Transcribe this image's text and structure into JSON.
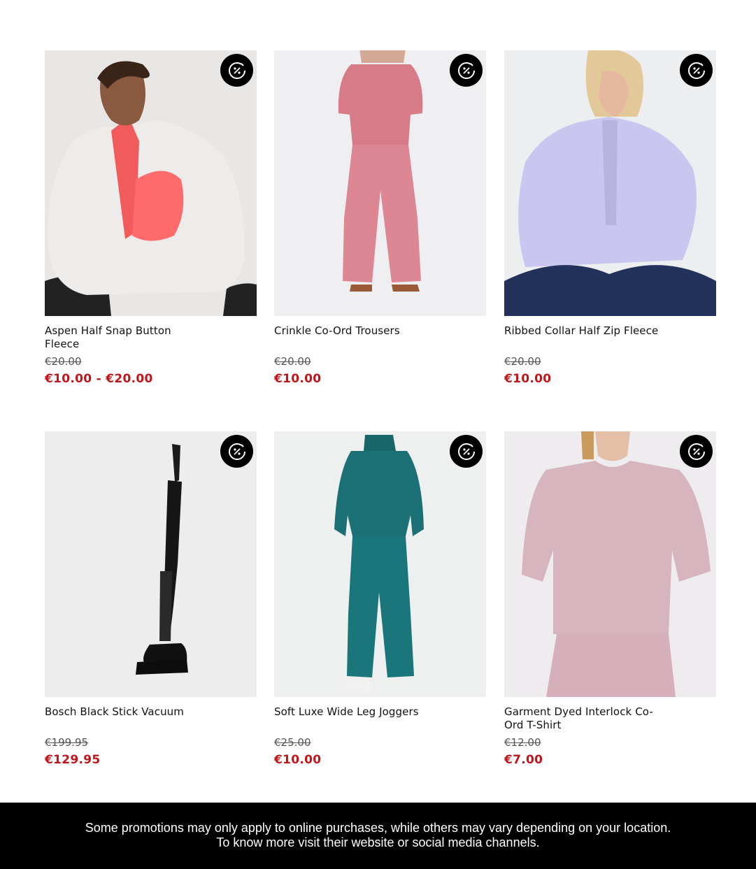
{
  "products": [
    {
      "name": "Aspen Half Snap Button Fleece",
      "old_price": "€20.00",
      "price": "€10.00 - €20.00",
      "promo_icon": "discount-badge-icon"
    },
    {
      "name": "Crinkle Co-Ord Trousers",
      "old_price": "€20.00",
      "price": "€10.00",
      "promo_icon": "discount-badge-icon"
    },
    {
      "name": "Ribbed Collar Half Zip Fleece",
      "old_price": "€20.00",
      "price": "€10.00",
      "promo_icon": "discount-badge-icon"
    },
    {
      "name": "Bosch Black Stick Vacuum",
      "old_price": "€199.95",
      "price": "€129.95",
      "promo_icon": "discount-badge-icon"
    },
    {
      "name": "Soft Luxe Wide Leg Joggers",
      "old_price": "€25.00",
      "price": "€10.00",
      "promo_icon": "discount-badge-icon"
    },
    {
      "name": "Garment Dyed Interlock Co-Ord T-Shirt",
      "old_price": "€12.00",
      "price": "€7.00",
      "promo_icon": "discount-badge-icon"
    }
  ],
  "footer": {
    "line1": "Some promotions may only apply to online purchases, while others may vary depending on your location.",
    "line2": "To know more visit their website or social media channels."
  },
  "colors": {
    "sale_price": "#c0161b",
    "footer_bg": "#000000"
  }
}
